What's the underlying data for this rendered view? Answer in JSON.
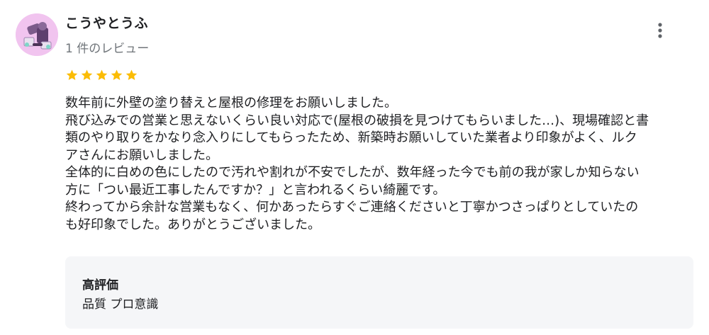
{
  "author": {
    "name": "こうやとうふ",
    "review_count": "1 件のレビュー"
  },
  "menu": {
    "icon": "more-vert-icon"
  },
  "rating": {
    "stars": 5,
    "max": 5,
    "color": "#fbbc04"
  },
  "review": {
    "lines": [
      "数年前に外壁の塗り替えと屋根の修理をお願いしました。",
      "飛び込みでの営業と思えないくらい良い対応で(屋根の破損を見つけてもらいました…)、現場確認と書",
      "類のやり取りをかなり念入りにしてもらったため、新築時お願いしていた業者より印象がよく、ルク",
      "アさんにお願いしました。",
      "全体的に白めの色にしたので汚れや割れが不安でしたが、数年経った今でも前の我が家しか知らない",
      "方に「つい最近工事したんですか？」と言われるくらい綺麗です。",
      "終わってから余計な営業もなく、何かあったらすぐご連絡くださいと丁寧かつさっぱりとしていたの",
      "も好印象でした。ありがとうございました。"
    ]
  },
  "attributes": {
    "title": "高評価",
    "values": "品質 プロ意識"
  }
}
